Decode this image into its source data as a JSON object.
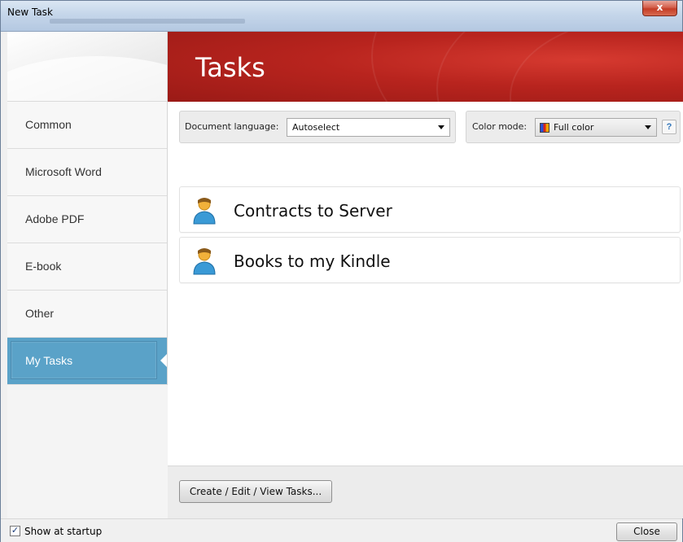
{
  "window": {
    "title": "New Task",
    "close_glyph": "x"
  },
  "banner": {
    "title": "Tasks"
  },
  "sidebar": {
    "items": [
      {
        "label": "Common"
      },
      {
        "label": "Microsoft Word"
      },
      {
        "label": "Adobe PDF"
      },
      {
        "label": "E-book"
      },
      {
        "label": "Other"
      },
      {
        "label": "My Tasks",
        "selected": true
      }
    ]
  },
  "toolbar": {
    "doc_language_label": "Document language:",
    "doc_language_value": "Autoselect",
    "color_mode_label": "Color mode:",
    "color_mode_value": "Full color",
    "help_glyph": "?"
  },
  "tasks": [
    {
      "name": "Contracts to Server",
      "icon": "person-icon"
    },
    {
      "name": "Books to my Kindle",
      "icon": "person-icon"
    }
  ],
  "footer": {
    "manage_button": "Create / Edit / View Tasks..."
  },
  "status": {
    "show_at_startup_label": "Show at startup",
    "show_at_startup_checked": true,
    "check_glyph": "✓",
    "close_button": "Close"
  },
  "colors": {
    "banner_red": "#b8241e",
    "selected_blue": "#5aa2c8"
  }
}
